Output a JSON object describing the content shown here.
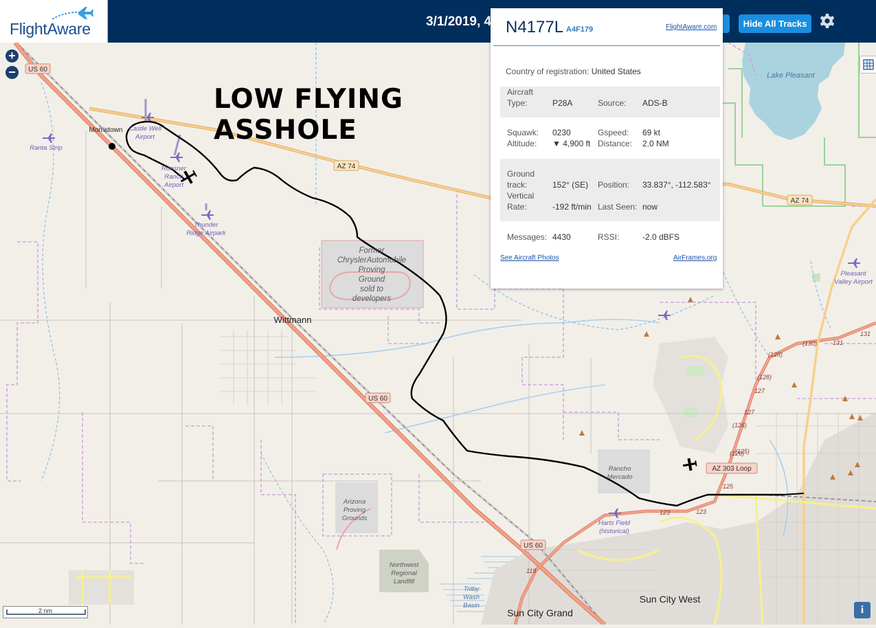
{
  "header": {
    "logo_text": "FlightAware",
    "date_partial": "3/1/2019, 4",
    "hide_tracks_label": "Hide All Tracks"
  },
  "map_controls": {
    "zoom_in": "+",
    "zoom_out": "−",
    "info": "i",
    "scale_label": "2 nm"
  },
  "annotation": {
    "line1": "LOW FLYING",
    "line2": "ASSHOLE"
  },
  "popup": {
    "registration": "N4177L",
    "hex": "A4F179",
    "link_fa": "FlightAware.com",
    "country_label": "Country of registration:",
    "country_value": "United States",
    "aircraft_type_label_1": "Aircraft",
    "aircraft_type_label_2": "Type:",
    "aircraft_type": "P28A",
    "source_label": "Source:",
    "source": "ADS-B",
    "squawk_label": "Squawk:",
    "squawk": "0230",
    "gspeed_label": "Gspeed:",
    "gspeed": "69 kt",
    "altitude_label": "Altitude:",
    "altitude": "▼ 4,900 ft",
    "distance_label": "Distance:",
    "distance": "2.0 NM",
    "ground_track_label_1": "Ground",
    "ground_track_label_2": "track:",
    "ground_track": "152° (SE)",
    "position_label": "Position:",
    "position": "33.837°, -112.583°",
    "vertical_rate_label_1": "Vertical",
    "vertical_rate_label_2": "Rate:",
    "vertical_rate": "-192 ft/min",
    "last_seen_label": "Last Seen:",
    "last_seen": "now",
    "messages_label": "Messages:",
    "messages": "4430",
    "rssi_label": "RSSI:",
    "rssi": "-2.0 dBFS",
    "link_photos": "See Aircraft Photos",
    "link_airframes": "AirFrames.org"
  },
  "map_labels": {
    "morristown": "Morristown",
    "wittmann": "Wittmann",
    "ranta": "Ranta Strip",
    "castle_well_1": "Castle Well",
    "castle_well_2": "Airport",
    "roesner_1": "Roesner",
    "roesner_2": "Ranch",
    "roesner_3": "Airport",
    "thunder_1": "Thunder",
    "thunder_2": "Ridge Airpark",
    "chrysler_1": "Former",
    "chrysler_2": "ChryslerAutomobile",
    "chrysler_3": "Proving",
    "chrysler_4": "Ground",
    "chrysler_5": "sold to",
    "chrysler_6": "developers",
    "arizona_pg_1": "Arizona",
    "arizona_pg_2": "Proving",
    "arizona_pg_3": "Grounds",
    "nw_landfill_1": "Northwest",
    "nw_landfill_2": "Regional",
    "nw_landfill_3": "Landfill",
    "trilby_1": "Trilby",
    "trilby_2": "Wash",
    "trilby_3": "Basin",
    "rancho_1": "Rancho",
    "rancho_2": "Mercado",
    "harts_1": "Harts Field",
    "harts_2": "(historical)",
    "lake_pleasant": "Lake Pleasant",
    "pleasant_valley_1": "Pleasant",
    "pleasant_valley_2": "Valley Airport",
    "sun_city_grand": "Sun City Grand",
    "sun_city_west": "Sun City West",
    "us60_a": "US 60",
    "us60_b": "US 60",
    "us60_c": "US 60",
    "az74_a": "AZ 74",
    "az74_b": "AZ 74",
    "az303": "AZ 303 Loop",
    "r119": "119",
    "r123a": "123",
    "r123b": "123",
    "r125a": "125",
    "r125b": "(125)",
    "r126a": "(126)",
    "r126b": "(126)",
    "r127a": "127",
    "r127b": "127",
    "r128a": "(128)",
    "r128b": "(128)",
    "r130": "(130)",
    "r131a": "131",
    "r131b": "131"
  },
  "colors": {
    "header_bg": "#002f5d",
    "button_blue": "#1a8ee0",
    "map_bg": "#f2efe9",
    "highway": "#e8927c",
    "state_route": "#f5c97a",
    "track": "#000000"
  }
}
